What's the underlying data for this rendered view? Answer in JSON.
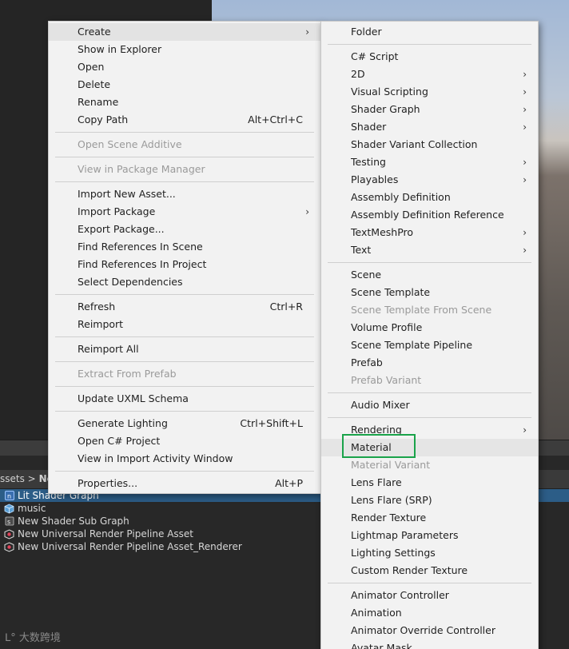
{
  "editor": {
    "breadcrumb": {
      "prefix": "ssets",
      "separator": ">",
      "current": "Ne"
    },
    "assets": [
      {
        "label": "Lit Shader Graph",
        "icon": "shader-graph-icon",
        "selected": true
      },
      {
        "label": "music",
        "icon": "package-icon",
        "selected": false
      },
      {
        "label": "New Shader Sub Graph",
        "icon": "subgraph-icon",
        "selected": false
      },
      {
        "label": "New Universal Render Pipeline Asset",
        "icon": "urp-asset-icon",
        "selected": false
      },
      {
        "label": "New Universal Render Pipeline Asset_Renderer",
        "icon": "urp-asset-icon",
        "selected": false
      }
    ],
    "watermark": "大数跨境",
    "accent": "#2c5d87",
    "annotation_color": "#1aa34a"
  },
  "main_menu": {
    "create": "Create",
    "show_in_explorer": "Show in Explorer",
    "open": "Open",
    "delete": "Delete",
    "rename": "Rename",
    "copy_path": "Copy Path",
    "copy_path_shortcut": "Alt+Ctrl+C",
    "open_scene_additive": "Open Scene Additive",
    "view_in_package_manager": "View in Package Manager",
    "import_new_asset": "Import New Asset...",
    "import_package": "Import Package",
    "export_package": "Export Package...",
    "find_refs_scene": "Find References In Scene",
    "find_refs_project": "Find References In Project",
    "select_dependencies": "Select Dependencies",
    "refresh": "Refresh",
    "refresh_shortcut": "Ctrl+R",
    "reimport": "Reimport",
    "reimport_all": "Reimport All",
    "extract_from_prefab": "Extract From Prefab",
    "update_uxml_schema": "Update UXML Schema",
    "generate_lighting": "Generate Lighting",
    "generate_lighting_shortcut": "Ctrl+Shift+L",
    "open_csharp_project": "Open C# Project",
    "view_in_import_activity": "View in Import Activity Window",
    "properties": "Properties...",
    "properties_shortcut": "Alt+P"
  },
  "submenu": {
    "folder": "Folder",
    "csharp_script": "C# Script",
    "twod": "2D",
    "visual_scripting": "Visual Scripting",
    "shader_graph": "Shader Graph",
    "shader": "Shader",
    "shader_variant_collection": "Shader Variant Collection",
    "testing": "Testing",
    "playables": "Playables",
    "assembly_definition": "Assembly Definition",
    "assembly_definition_reference": "Assembly Definition Reference",
    "textmeshpro": "TextMeshPro",
    "text": "Text",
    "scene": "Scene",
    "scene_template": "Scene Template",
    "scene_template_from_scene": "Scene Template From Scene",
    "volume_profile": "Volume Profile",
    "scene_template_pipeline": "Scene Template Pipeline",
    "prefab": "Prefab",
    "prefab_variant": "Prefab Variant",
    "audio_mixer": "Audio Mixer",
    "rendering": "Rendering",
    "material": "Material",
    "material_variant": "Material Variant",
    "lens_flare": "Lens Flare",
    "lens_flare_srp": "Lens Flare (SRP)",
    "render_texture": "Render Texture",
    "lightmap_parameters": "Lightmap Parameters",
    "lighting_settings": "Lighting Settings",
    "custom_render_texture": "Custom Render Texture",
    "animator_controller": "Animator Controller",
    "animation": "Animation",
    "animator_override_controller": "Animator Override Controller",
    "avatar_mask": "Avatar Mask"
  },
  "arrow_glyph": "›"
}
